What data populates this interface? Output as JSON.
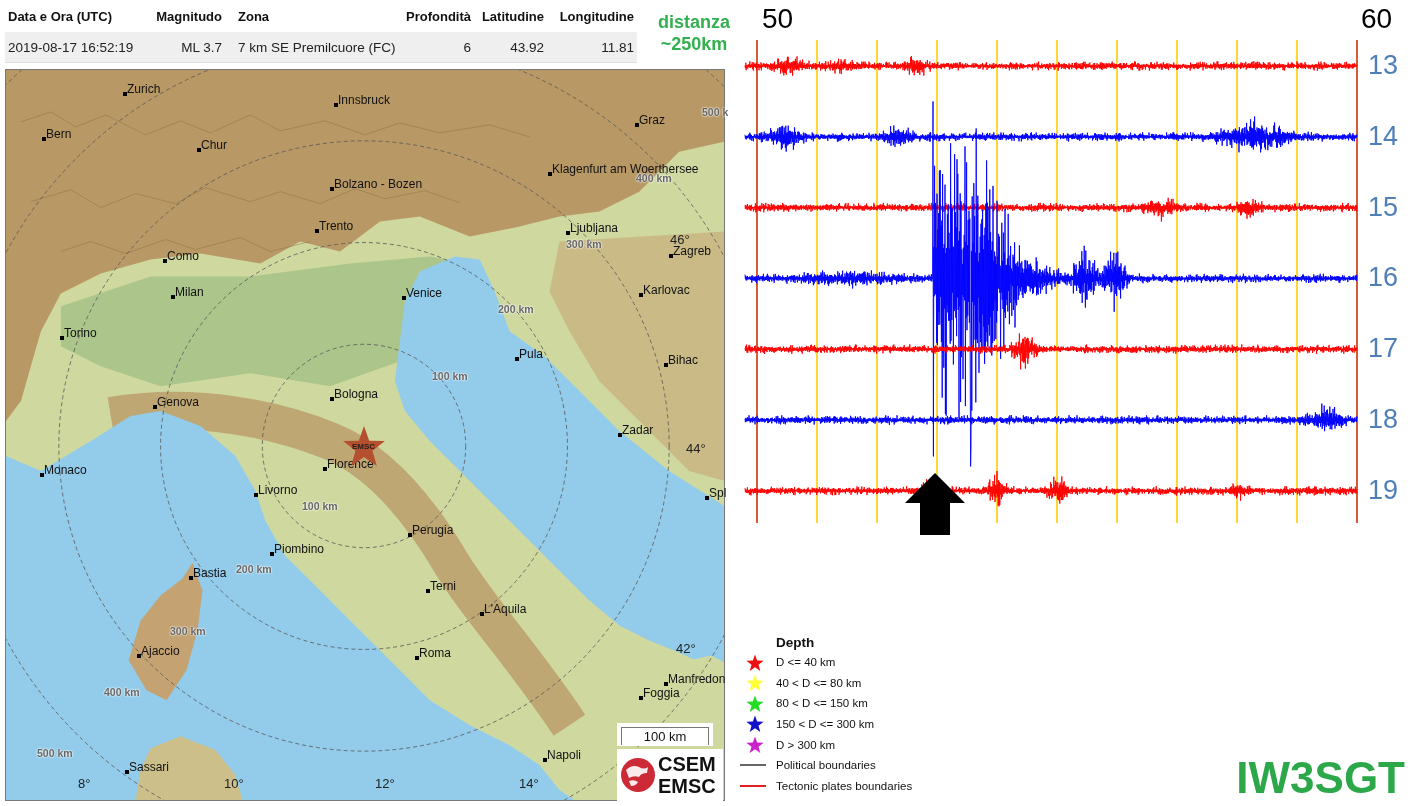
{
  "table": {
    "columns": [
      "Data e Ora (UTC)",
      "Magnitudo",
      "Zona",
      "Profondità",
      "Latitudine",
      "Longitudine"
    ],
    "rows": [
      [
        "2019-08-17 16:52:19",
        "ML 3.7",
        "7 km SE Premilcuore (FC)",
        "6",
        "43.92",
        "11.81"
      ]
    ]
  },
  "distance_note": "distanza ~250km",
  "map": {
    "cities": [
      "Zurich",
      "Innsbruck",
      "Bern",
      "Chur",
      "Graz",
      "Klagenfurt am Woerthersee",
      "Bolzano - Bozen",
      "Trento",
      "Ljubljana",
      "Como",
      "Zagreb",
      "Milan",
      "Venice",
      "Karlovac",
      "Torino",
      "Pula",
      "Bihac",
      "Bologna",
      "Genova",
      "Zadar",
      "Monaco",
      "Florence",
      "Livorno",
      "Spl",
      "Perugia",
      "Piombino",
      "Bastia",
      "Terni",
      "L'Aquila",
      "Ajaccio",
      "Roma",
      "Manfredon",
      "Foggia",
      "Napoli",
      "Sassari"
    ],
    "distance_labels": [
      "500 k",
      "400 km",
      "300 km",
      "200 km",
      "100 km",
      "100 km",
      "200 km",
      "300 km",
      "400 km",
      "500 km"
    ],
    "latitude_labels": [
      "46°",
      "44°",
      "42°"
    ],
    "longitude_labels": [
      "8°",
      "10°",
      "12°",
      "14°"
    ],
    "epicenter_label": "EMSC",
    "scale": "100 km",
    "logo": [
      "CSEM",
      "EMSC"
    ]
  },
  "seismogram": {
    "minute_labels": [
      "50",
      "60"
    ],
    "traces": [
      {
        "hour": "13",
        "color": "#ff0000"
      },
      {
        "hour": "14",
        "color": "#0000ff"
      },
      {
        "hour": "15",
        "color": "#ff0000"
      },
      {
        "hour": "16",
        "color": "#0000ff"
      },
      {
        "hour": "17",
        "color": "#ff0000"
      },
      {
        "hour": "18",
        "color": "#0000ff"
      },
      {
        "hour": "19",
        "color": "#ff0000"
      }
    ]
  },
  "legend": {
    "title": "Depth",
    "items": [
      {
        "kind": "star",
        "label": "D <= 40 km",
        "color": "#ee1111"
      },
      {
        "kind": "star",
        "label": "40 < D <= 80 km",
        "color": "#ffff33"
      },
      {
        "kind": "star",
        "label": "80 < D <= 150 km",
        "color": "#22dd22"
      },
      {
        "kind": "star",
        "label": "150 < D <= 300 km",
        "color": "#1111cc"
      },
      {
        "kind": "star",
        "label": "D > 300 km",
        "color": "#cc22cc"
      },
      {
        "kind": "line",
        "label": "Political boundaries",
        "color": "#666666"
      },
      {
        "kind": "line",
        "label": "Tectonic plates boundaries",
        "color": "#e02020"
      }
    ]
  },
  "callsign": "IW3SGT"
}
